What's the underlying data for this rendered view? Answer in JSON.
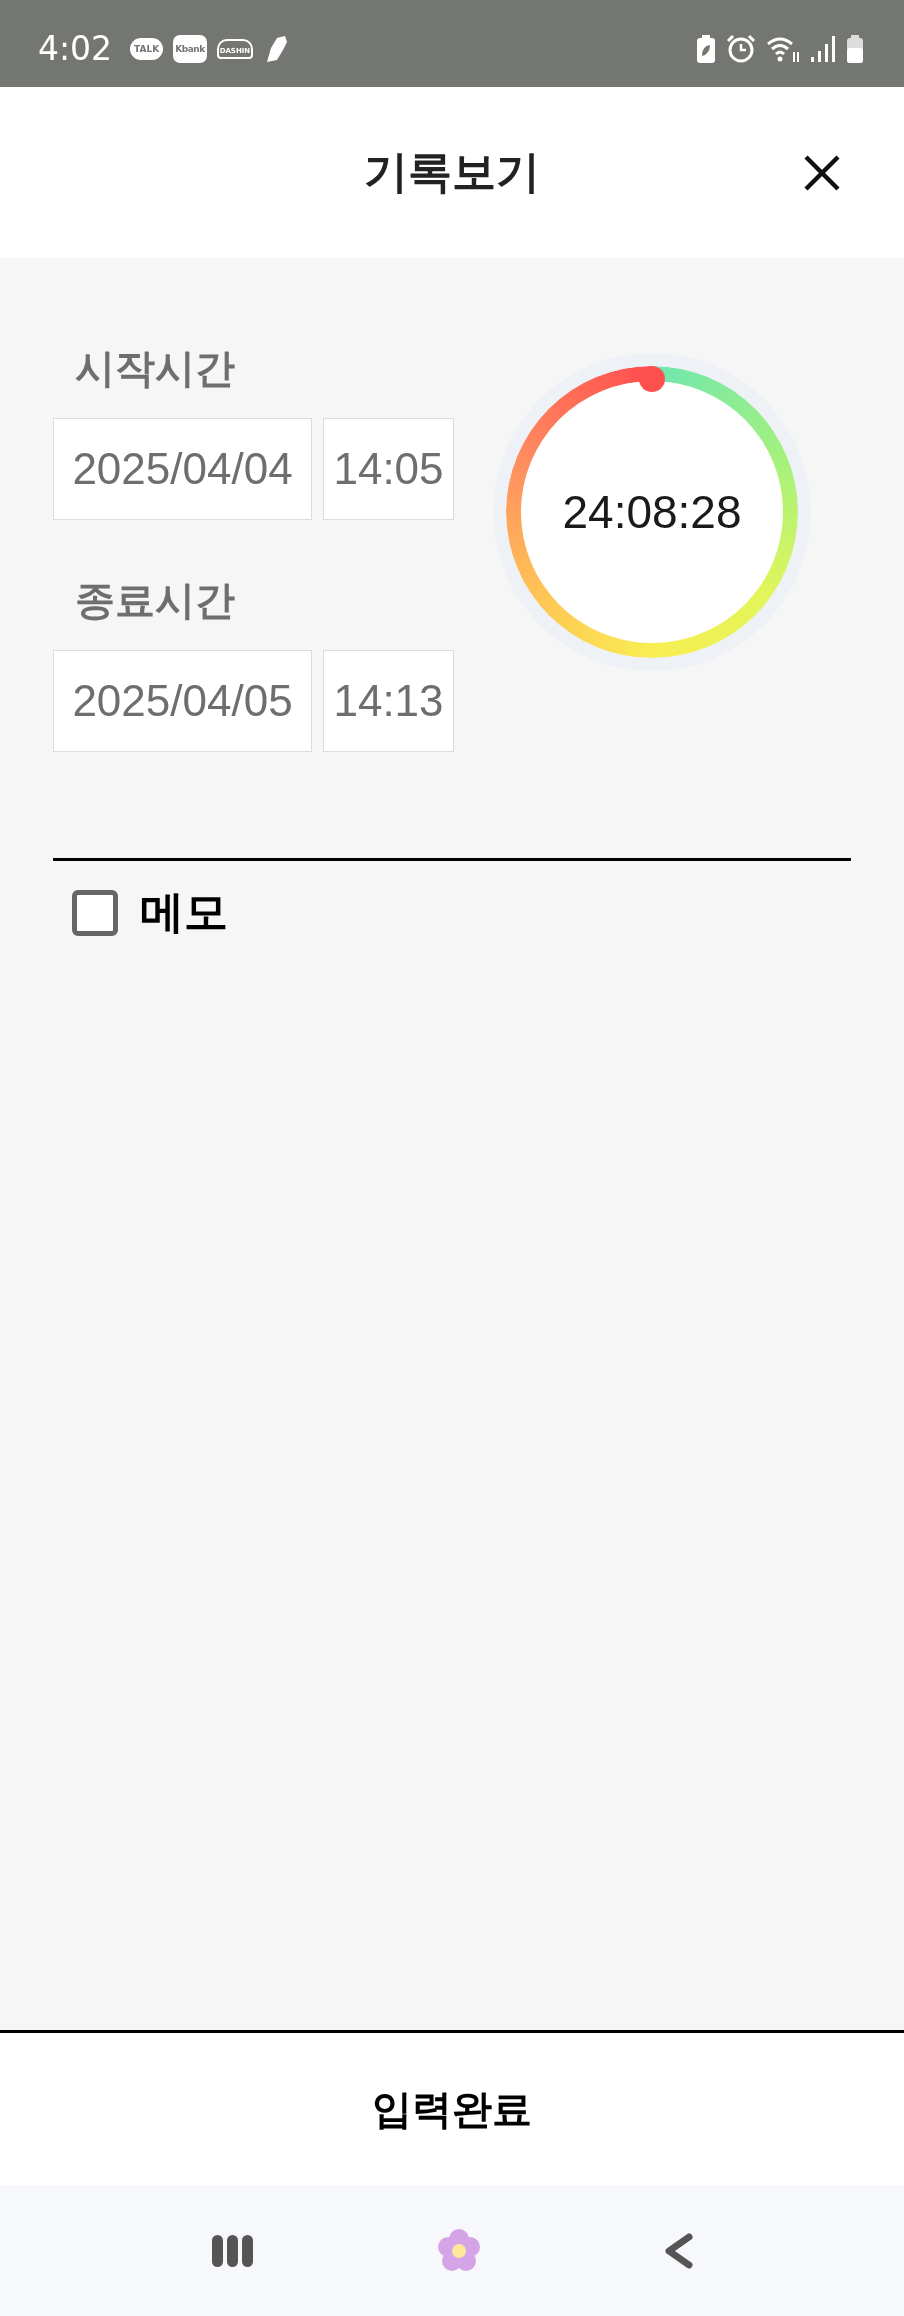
{
  "status_bar": {
    "time": "4:02",
    "app_badges": [
      {
        "kind": "bubble",
        "label": "TALK"
      },
      {
        "kind": "square",
        "label": "Kbank"
      },
      {
        "kind": "logo",
        "label": "DASHIN"
      }
    ]
  },
  "header": {
    "title": "기록보기"
  },
  "start": {
    "label": "시작시간",
    "date": "2025/04/04",
    "time": "14:05"
  },
  "end": {
    "label": "종료시간",
    "date": "2025/04/05",
    "time": "14:13"
  },
  "timer": {
    "elapsed": "24:08:28"
  },
  "memo": {
    "label": "메모",
    "checked": false
  },
  "submit_button": "입력완료"
}
